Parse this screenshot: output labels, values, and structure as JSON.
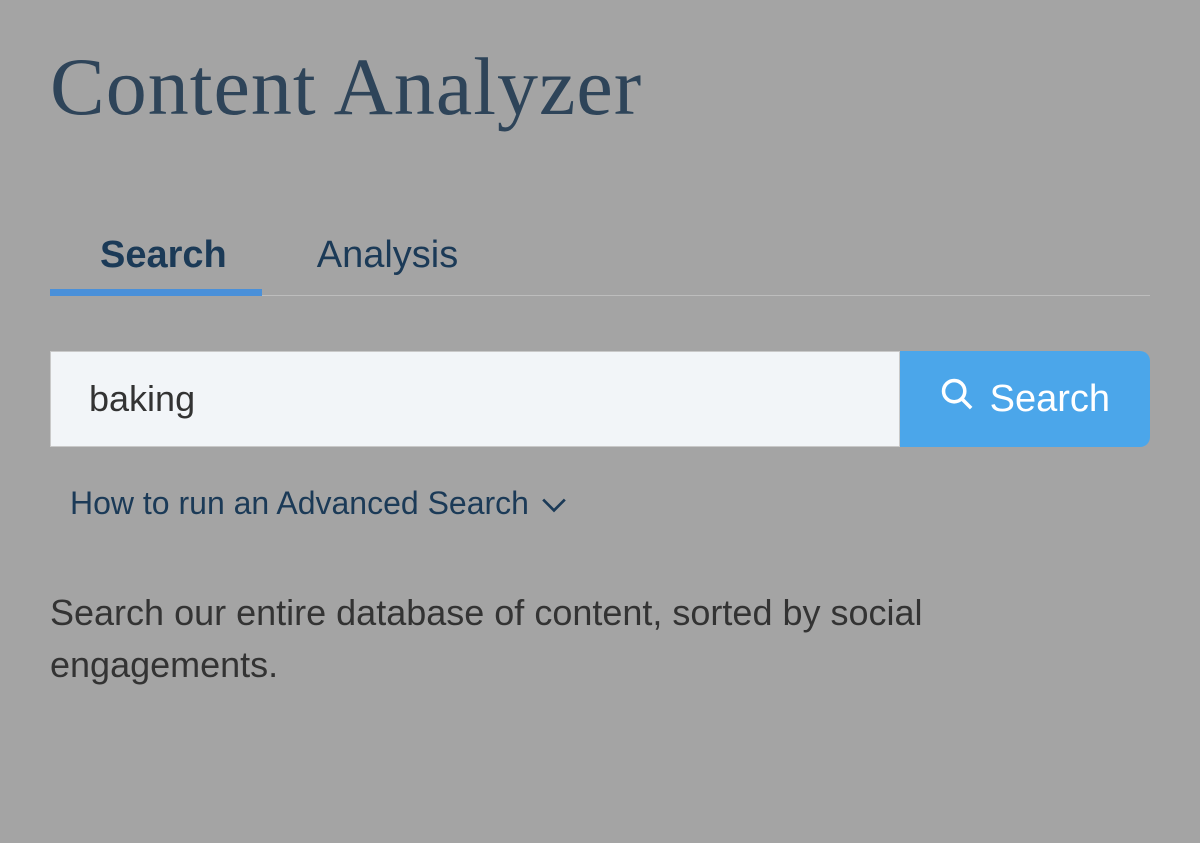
{
  "header": {
    "title": "Content Analyzer"
  },
  "tabs": {
    "search_label": "Search",
    "analysis_label": "Analysis"
  },
  "search": {
    "input_value": "baking",
    "button_label": "Search",
    "advanced_link": "How to run an Advanced Search"
  },
  "description": "Search our entire database of content, sorted by social engagements."
}
